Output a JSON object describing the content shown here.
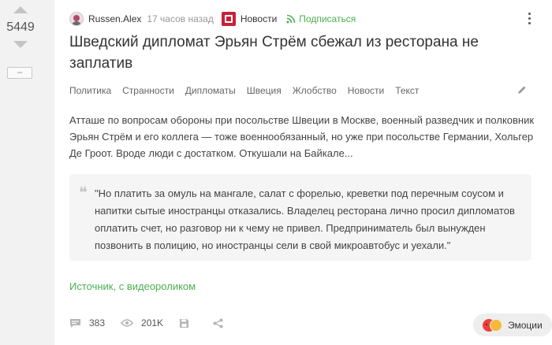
{
  "rating": {
    "value": "5449",
    "collapse_label": "–"
  },
  "post": {
    "author": "Russen.Alex",
    "time": "17 часов назад",
    "community": "Новости",
    "subscribe_label": "Подписаться",
    "title": "Шведский дипломат Эрьян Стрём сбежал из ресторана не заплатив",
    "tags": [
      "Политика",
      "Странности",
      "Дипломаты",
      "Швеция",
      "Жлобство",
      "Новости",
      "Текст"
    ],
    "body": "Атташе по вопросам обороны при посольстве Швеции в Москве, военный разведчик и полковник Эрьян Стрём и его коллега — тоже военнообязанный, но уже при посольстве Германии, Хольгер Де Гроот. Вроде люди с достатком. Откушали на Байкале...",
    "quote": "\"Но платить за омуль на мангале, салат с форелью, креветки под перечным соусом и напитки сытые иностранцы отказались. Владелец ресторана лично просил дипломатов оплатить счет, но разговор ни к чему не привел. Предприниматель был вынужден позвонить в полицию, но иностранцы сели в свой микроавтобус и уехали.\"",
    "quote_mark": "❝",
    "source_link": "Источник, с видеороликом"
  },
  "footer": {
    "comments_count": "383",
    "views_count": "201K",
    "reactions_label": "Эмоции"
  },
  "colors": {
    "accent_green": "#4caf50",
    "background": "#f2f2f2",
    "card": "#ffffff"
  },
  "icons": [
    "arrow-up-icon",
    "arrow-down-icon",
    "avatar",
    "community-icon",
    "subscribe-icon",
    "more-icon",
    "edit-icon",
    "comments-icon",
    "views-icon",
    "save-icon",
    "share-icon",
    "emoji-icon"
  ]
}
